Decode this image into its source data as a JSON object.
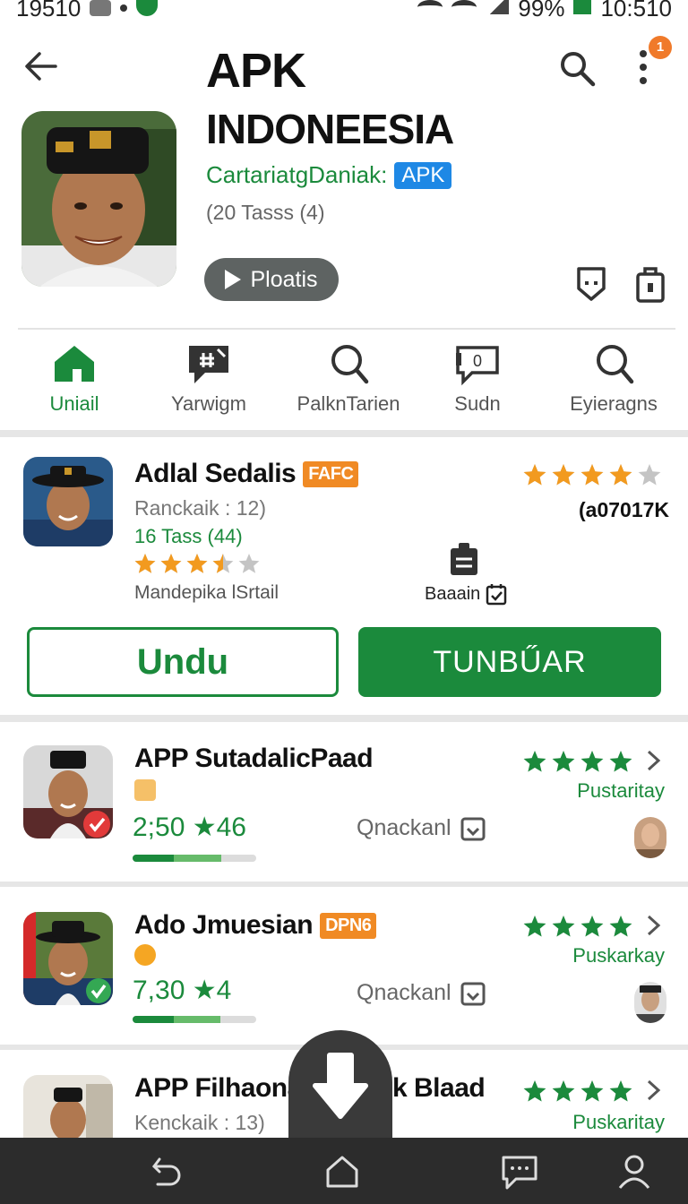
{
  "status_bar": {
    "time_left": "19510",
    "battery": "99%",
    "time_right": "10:510"
  },
  "header": {
    "title_line1": "APK",
    "title_line2": "INDONEESIA",
    "developer": "CartariatgDaniak:",
    "apk_badge": "APK",
    "size_info": "(20 Tasss (4)",
    "play_label": "Ploatis",
    "notification_count": "1"
  },
  "tabs": [
    {
      "label": "Uniail",
      "icon": "home-icon",
      "active": true
    },
    {
      "label": "Yarwigm",
      "icon": "chat-edit-icon",
      "active": false
    },
    {
      "label": "PalknTarien",
      "icon": "search-icon",
      "active": false
    },
    {
      "label": "Sudn",
      "icon": "message-count-icon",
      "badge": "0",
      "active": false
    },
    {
      "label": "Eyieragns",
      "icon": "search-icon",
      "active": false
    }
  ],
  "featured": {
    "title": "Adlal Sedalis",
    "tag": "FAFC",
    "rank": "Ranckaik : 12)",
    "size": "16 Tass (44)",
    "rating_left": 3.5,
    "category": "Mandepika lSrtail",
    "rating_right": 4,
    "review_count": "(a07017K",
    "bazaar_label": "Baaain",
    "btn_outline": "Undu",
    "btn_fill": "TUNBŰAR"
  },
  "list": [
    {
      "title": "APP SutadalicPaad",
      "metric": "2;50 ★46",
      "meta": "Qnackanl",
      "label": "Pustaritay",
      "rating": 4,
      "progress": [
        0.33,
        0.72
      ]
    },
    {
      "title": "Ado Jmuesian",
      "tag": "DPN6",
      "metric": "7,30 ★4",
      "meta": "Qnackanl",
      "label": "Puskarkay",
      "rating": 4,
      "progress": [
        0.33,
        0.71
      ]
    },
    {
      "title": "APP Filhaona",
      "title_tail": "k Blaad",
      "sub": "Kenckaik : 13)",
      "label": "Puskaritay",
      "rating": 4
    }
  ],
  "colors": {
    "accent": "#1b8a3c",
    "star_orange": "#f29a1f",
    "tag_orange": "#f08a24",
    "nav_bg": "#2c2c2c"
  }
}
